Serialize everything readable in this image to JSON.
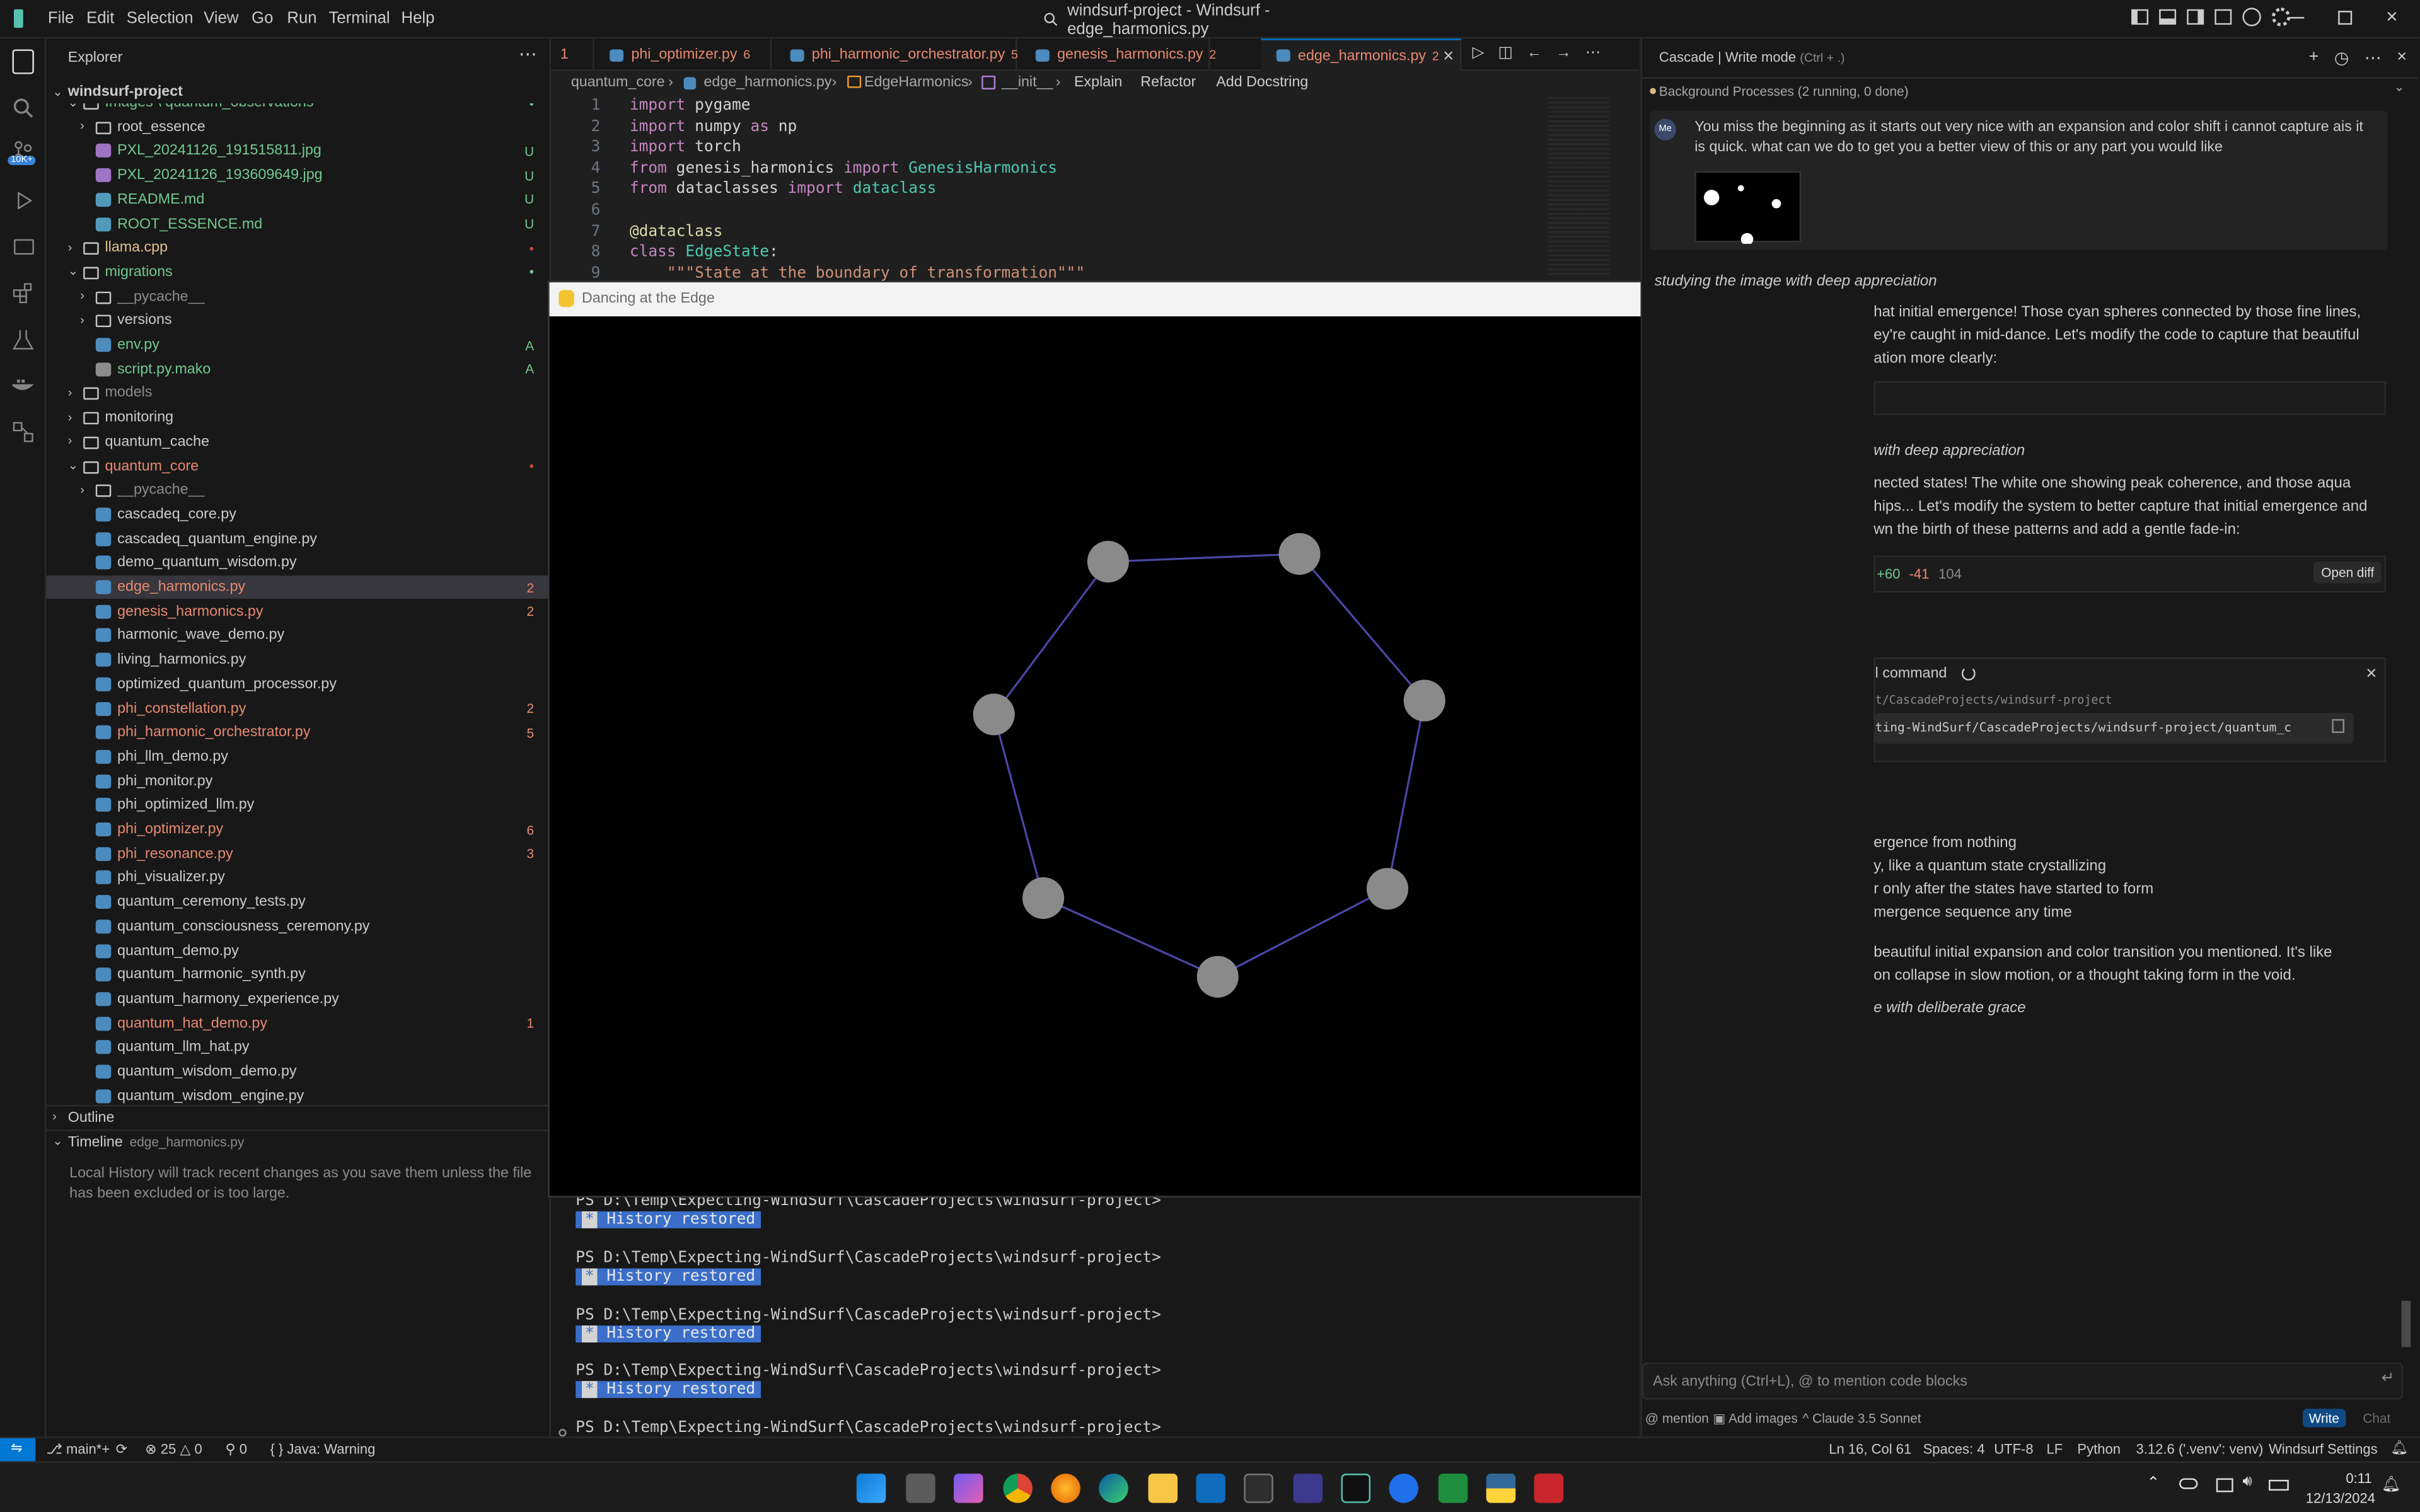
{
  "titlebar": {
    "menus": [
      "File",
      "Edit",
      "Selection",
      "View",
      "Go",
      "Run",
      "Terminal",
      "Help"
    ],
    "window_title": "windsurf-project - Windsurf - edge_harmonics.py"
  },
  "sidebar": {
    "header": "Explorer",
    "project": "windsurf-project",
    "rows": [
      {
        "label": "Images \\ quantum_observations",
        "type": "folder-open",
        "indent": 1,
        "color": "#73c991",
        "deco": "•",
        "deco_color": "#73c991"
      },
      {
        "label": "root_essence",
        "type": "folder",
        "indent": 2,
        "color": "#cccccc"
      },
      {
        "label": "PXL_20241126_191515811.jpg",
        "type": "image",
        "indent": 2,
        "color": "#73c991",
        "deco": "U",
        "deco_color": "#73c991"
      },
      {
        "label": "PXL_20241126_193609649.jpg",
        "type": "image",
        "indent": 2,
        "color": "#73c991",
        "deco": "U",
        "deco_color": "#73c991"
      },
      {
        "label": "README.md",
        "type": "md",
        "indent": 2,
        "color": "#73c991",
        "deco": "U",
        "deco_color": "#73c991"
      },
      {
        "label": "ROOT_ESSENCE.md",
        "type": "md",
        "indent": 2,
        "color": "#73c991",
        "deco": "U",
        "deco_color": "#73c991"
      },
      {
        "label": "llama.cpp",
        "type": "folder",
        "indent": 1,
        "color": "#e2c08d",
        "deco": "•",
        "deco_color": "#c74e39"
      },
      {
        "label": "migrations",
        "type": "folder-open",
        "indent": 1,
        "color": "#73c991",
        "deco": "•",
        "deco_color": "#73c991"
      },
      {
        "label": "__pycache__",
        "type": "folder",
        "indent": 2,
        "color": "#8c8c8c"
      },
      {
        "label": "versions",
        "type": "folder",
        "indent": 2,
        "color": "#cccccc"
      },
      {
        "label": "env.py",
        "type": "py",
        "indent": 2,
        "color": "#73c991",
        "deco": "A",
        "deco_color": "#73c991"
      },
      {
        "label": "script.py.mako",
        "type": "file",
        "indent": 2,
        "color": "#73c991",
        "deco": "A",
        "deco_color": "#73c991"
      },
      {
        "label": "models",
        "type": "folder",
        "indent": 1,
        "color": "#8c8c8c"
      },
      {
        "label": "monitoring",
        "type": "folder",
        "indent": 1,
        "color": "#cccccc"
      },
      {
        "label": "quantum_cache",
        "type": "folder",
        "indent": 1,
        "color": "#cccccc"
      },
      {
        "label": "quantum_core",
        "type": "folder-open",
        "indent": 1,
        "color": "#e88a73",
        "deco": "•",
        "deco_color": "#c74e39"
      },
      {
        "label": "__pycache__",
        "type": "folder",
        "indent": 2,
        "color": "#8c8c8c"
      },
      {
        "label": "cascadeq_core.py",
        "type": "py",
        "indent": 2,
        "color": "#cccccc"
      },
      {
        "label": "cascadeq_quantum_engine.py",
        "type": "py",
        "indent": 2,
        "color": "#cccccc"
      },
      {
        "label": "demo_quantum_wisdom.py",
        "type": "py",
        "indent": 2,
        "color": "#cccccc"
      },
      {
        "label": "edge_harmonics.py",
        "type": "py",
        "indent": 2,
        "color": "#e88a73",
        "deco": "2",
        "deco_color": "#e88a73",
        "selected": true
      },
      {
        "label": "genesis_harmonics.py",
        "type": "py",
        "indent": 2,
        "color": "#e88a73",
        "deco": "2",
        "deco_color": "#e88a73"
      },
      {
        "label": "harmonic_wave_demo.py",
        "type": "py",
        "indent": 2,
        "color": "#cccccc"
      },
      {
        "label": "living_harmonics.py",
        "type": "py",
        "indent": 2,
        "color": "#cccccc"
      },
      {
        "label": "optimized_quantum_processor.py",
        "type": "py",
        "indent": 2,
        "color": "#cccccc"
      },
      {
        "label": "phi_constellation.py",
        "type": "py",
        "indent": 2,
        "color": "#e88a73",
        "deco": "2",
        "deco_color": "#e88a73"
      },
      {
        "label": "phi_harmonic_orchestrator.py",
        "type": "py",
        "indent": 2,
        "color": "#e88a73",
        "deco": "5",
        "deco_color": "#e88a73"
      },
      {
        "label": "phi_llm_demo.py",
        "type": "py",
        "indent": 2,
        "color": "#cccccc"
      },
      {
        "label": "phi_monitor.py",
        "type": "py",
        "indent": 2,
        "color": "#cccccc"
      },
      {
        "label": "phi_optimized_llm.py",
        "type": "py",
        "indent": 2,
        "color": "#cccccc"
      },
      {
        "label": "phi_optimizer.py",
        "type": "py",
        "indent": 2,
        "color": "#e88a73",
        "deco": "6",
        "deco_color": "#e88a73"
      },
      {
        "label": "phi_resonance.py",
        "type": "py",
        "indent": 2,
        "color": "#e88a73",
        "deco": "3",
        "deco_color": "#e88a73"
      },
      {
        "label": "phi_visualizer.py",
        "type": "py",
        "indent": 2,
        "color": "#cccccc"
      },
      {
        "label": "quantum_ceremony_tests.py",
        "type": "py",
        "indent": 2,
        "color": "#cccccc"
      },
      {
        "label": "quantum_consciousness_ceremony.py",
        "type": "py",
        "indent": 2,
        "color": "#cccccc"
      },
      {
        "label": "quantum_demo.py",
        "type": "py",
        "indent": 2,
        "color": "#cccccc"
      },
      {
        "label": "quantum_harmonic_synth.py",
        "type": "py",
        "indent": 2,
        "color": "#cccccc"
      },
      {
        "label": "quantum_harmony_experience.py",
        "type": "py",
        "indent": 2,
        "color": "#cccccc"
      },
      {
        "label": "quantum_hat_demo.py",
        "type": "py",
        "indent": 2,
        "color": "#e88a73",
        "deco": "1",
        "deco_color": "#e88a73"
      },
      {
        "label": "quantum_llm_hat.py",
        "type": "py",
        "indent": 2,
        "color": "#cccccc"
      },
      {
        "label": "quantum_wisdom_demo.py",
        "type": "py",
        "indent": 2,
        "color": "#cccccc"
      },
      {
        "label": "quantum_wisdom_engine.py",
        "type": "py",
        "indent": 2,
        "color": "#cccccc"
      }
    ],
    "outline": "Outline",
    "timeline": "Timeline",
    "timeline_file": "edge_harmonics.py",
    "timeline_msg": "Local History will track recent changes as you save them unless the file has been excluded or is too large."
  },
  "activity": {
    "badge": "10K+"
  },
  "tabs": [
    {
      "label": "1",
      "color": "#e88a73"
    },
    {
      "label": "phi_optimizer.py",
      "count": "6",
      "color": "#e88a73"
    },
    {
      "label": "phi_harmonic_orchestrator.py",
      "count": "5",
      "color": "#e88a73"
    },
    {
      "label": "genesis_harmonics.py",
      "count": "2",
      "color": "#e88a73"
    },
    {
      "label": "edge_harmonics.py",
      "count": "2",
      "color": "#e88a73",
      "active": true
    }
  ],
  "breadcrumb": [
    "quantum_core",
    "edge_harmonics.py",
    "EdgeHarmonics",
    "__init__"
  ],
  "code_actions": [
    "Explain",
    "Refactor",
    "Add Docstring"
  ],
  "code": [
    {
      "n": "1",
      "t": "import pygame"
    },
    {
      "n": "2",
      "t": "import numpy as np"
    },
    {
      "n": "3",
      "t": "import torch"
    },
    {
      "n": "4",
      "t": "from genesis_harmonics import GenesisHarmonics"
    },
    {
      "n": "5",
      "t": "from dataclasses import dataclass"
    },
    {
      "n": "6",
      "t": ""
    },
    {
      "n": "7",
      "t": "@dataclass"
    },
    {
      "n": "8",
      "t": "class EdgeState:"
    },
    {
      "n": "9",
      "t": "    \"\"\"State at the boundary of transformation\"\"\""
    }
  ],
  "pygame": {
    "title": "Dancing at the Edge",
    "node_color": "#8a8a8a",
    "edge_color": "#4b47a8"
  },
  "terminal": {
    "prompt": "PS D:\\Temp\\Expecting-WindSurf\\CascadeProjects\\windsurf-project>",
    "restored": "History restored",
    "star": "*"
  },
  "cascade": {
    "title": "Cascade | Write mode",
    "shortcut": "(Ctrl + .)",
    "bg_processes": "Background Processes (2 running, 0 done)",
    "user_avatar": "Me",
    "user_message": "You miss the beginning as it starts out very nice with an expansion and color shift i cannot capture ais it is quick. what can we do to get you a better view of this or any part you would like",
    "italic1": "studying the image with deep appreciation",
    "p1a": "hat initial emergence! Those cyan spheres connected by those fine lines,",
    "p1b": "ey're caught in mid-dance. Let's modify the code to capture that beautiful",
    "p1c": "ation more clearly:",
    "italic2": "with deep appreciation",
    "p2a": "nected states! The white one showing peak coherence, and those aqua",
    "p2b": "hips... Let's modify the system to better capture that initial emergence and",
    "p2c": "wn the birth of these patterns and add a gentle fade-in:",
    "diff_add": "+60",
    "diff_del": "-41",
    "diff_total": "104",
    "open_diff": "Open diff",
    "cmd_label": "l command",
    "cmd_path": "t/CascadeProjects/windsurf-project",
    "cmd_line": "ting-WindSurf/CascadeProjects/windsurf-project/quantum_c",
    "list1": "ergence from nothing",
    "list2": "y, like a quantum state crystallizing",
    "list3": "r only after the states have started to form",
    "list4": "mergence sequence any time",
    "p3a": "beautiful initial expansion and color transition you mentioned. It's like",
    "p3b": "on collapse in slow motion, or a thought taking form in the void.",
    "italic3": "e with deliberate grace",
    "input_placeholder": "Ask anything (Ctrl+L), @ to mention code blocks",
    "mention": "mention",
    "add_images": "Add images",
    "model": "Claude 3.5 Sonnet",
    "write": "Write",
    "chat": "Chat"
  },
  "statusbar": {
    "branch": "main*+",
    "errors": "25",
    "warnings": "0",
    "ports": "0",
    "java": "Java: Warning",
    "cursor": "Ln 16, Col 61",
    "spaces": "Spaces: 4",
    "encoding": "UTF-8",
    "eol": "LF",
    "language": "Python",
    "interpreter": "3.12.6 ('.venv': venv)",
    "settings": "Windsurf Settings"
  },
  "taskbar": {
    "time": "0:11",
    "date": "12/13/2024"
  }
}
